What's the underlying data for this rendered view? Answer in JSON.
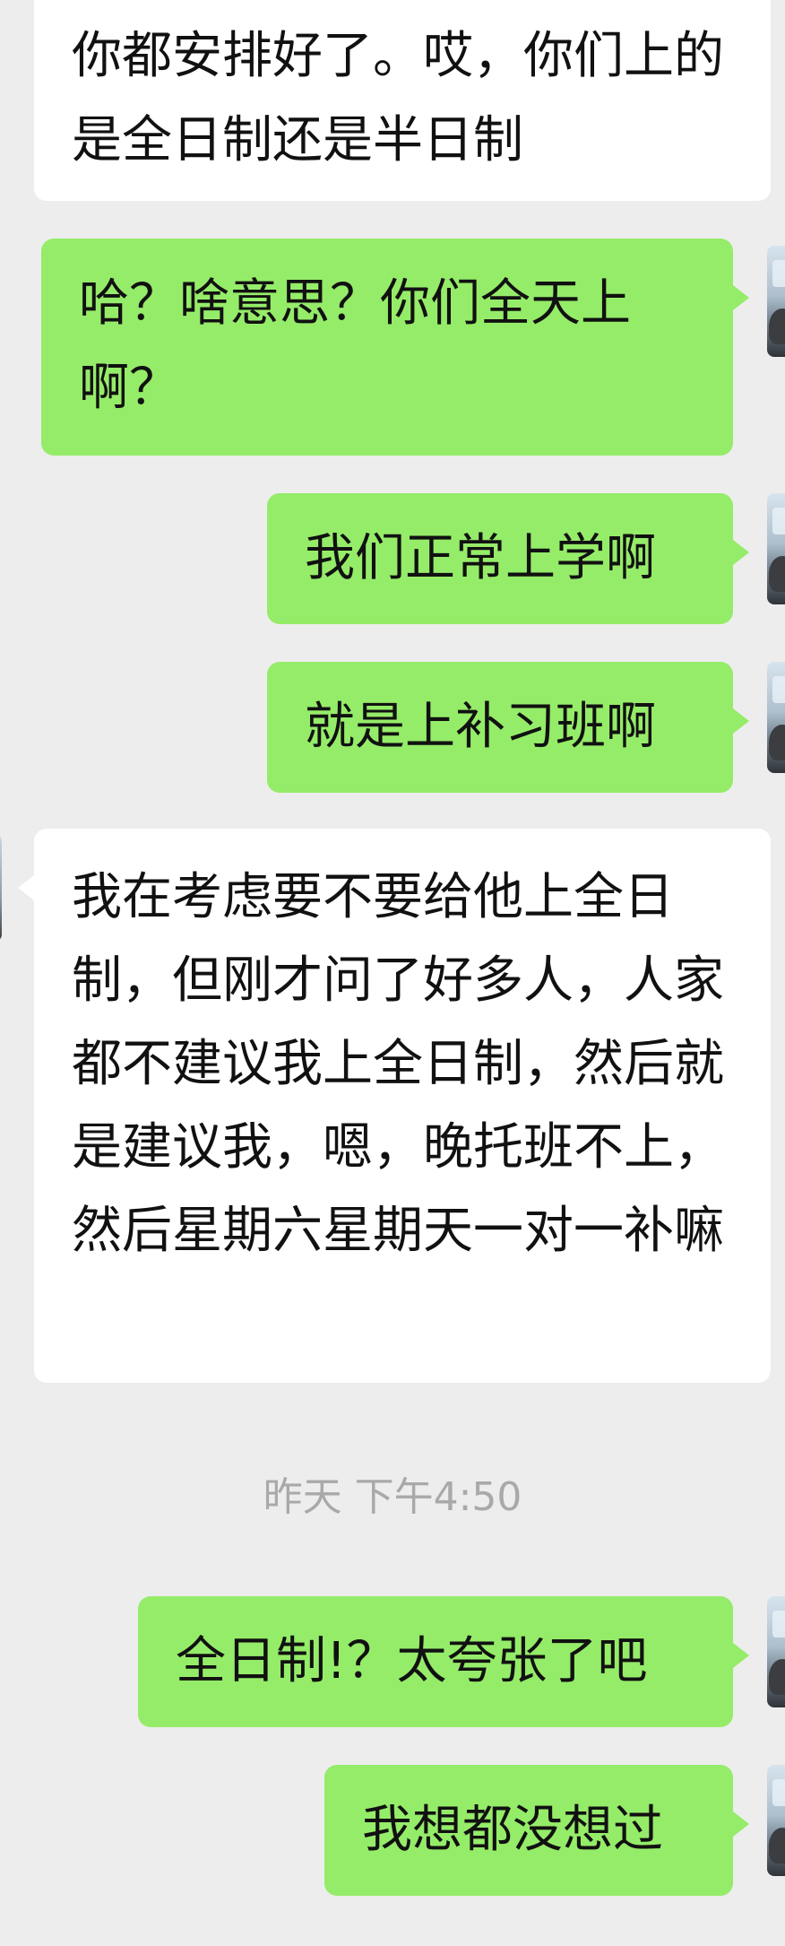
{
  "messages": [
    {
      "side": "in",
      "text": "你都安排好了。哎，你们上的是全日制还是半日制"
    },
    {
      "side": "out",
      "text": "哈？啥意思？你们全天上啊？"
    },
    {
      "side": "out",
      "text": "我们正常上学啊"
    },
    {
      "side": "out",
      "text": "就是上补习班啊"
    },
    {
      "side": "in",
      "text": "我在考虑要不要给他上全日制，但刚才问了好多人，人家都不建议我上全日制，然后就是建议我，嗯，晚托班不上，然后星期六星期天一对一补嘛"
    },
    {
      "side": "out",
      "text": "全日制!？太夸张了吧"
    },
    {
      "side": "out",
      "text": "我想都没想过"
    }
  ],
  "timestamp": "昨天 下午4:50",
  "colors": {
    "background": "#ededed",
    "incoming_bubble": "#ffffff",
    "outgoing_bubble": "#95ec69",
    "timestamp_text": "#a9a9a9"
  },
  "icons": {
    "avatar": "user-avatar-icon"
  }
}
